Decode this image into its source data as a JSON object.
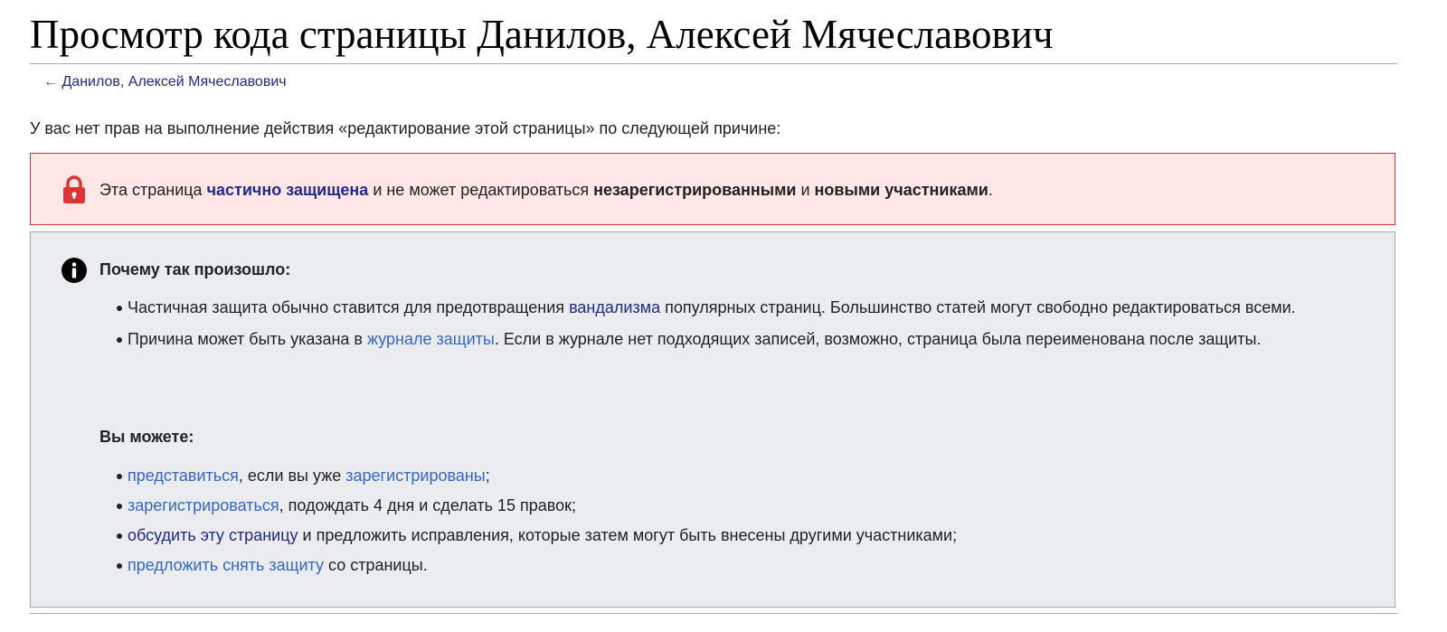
{
  "title": "Просмотр кода страницы Данилов, Алексей Мячеславович",
  "backlink": {
    "arrow": "←",
    "label": "Данилов, Алексей Мячеславович"
  },
  "reason": "У вас нет прав на выполнение действия «редактирование этой страницы» по следующей причине:",
  "protection": {
    "icon": "lock-icon",
    "t1": "Эта страница ",
    "link": "частично защищена",
    "t2": " и не может редактироваться ",
    "b1": "незарегистрированными",
    "t3": " и ",
    "b2": "новыми участниками",
    "t4": "."
  },
  "why": {
    "icon": "info-icon",
    "heading": "Почему так произошло:",
    "items": [
      {
        "t1": "Частичная защита обычно ставится для предотвращения ",
        "link": "вандализма",
        "t2": " популярных страниц. Большинство статей могут свободно редактироваться всеми."
      },
      {
        "t1": "Причина может быть указана в ",
        "link": "журнале защиты",
        "t2": ". Если в журнале нет подходящих записей, возможно, страница была переименована после защиты."
      }
    ]
  },
  "can": {
    "heading": "Вы можете:",
    "items": [
      {
        "link1": "представиться",
        "t1": ", если вы уже ",
        "link2": "зарегистрированы",
        "t2": ";"
      },
      {
        "link": "зарегистрироваться",
        "t": ", подождать 4 дня и сделать 15 правок;"
      },
      {
        "link": "обсудить эту страницу",
        "t": " и предложить исправления, которые затем могут быть внесены другими участниками;"
      },
      {
        "link": "предложить снять защиту",
        "t": " со страницы."
      }
    ]
  },
  "colors": {
    "link": "#3366cc",
    "link_visited": "#202a8a",
    "protect_bg": "#fee7e6",
    "protect_border": "#dd3333",
    "info_bg": "#eaecf0"
  }
}
